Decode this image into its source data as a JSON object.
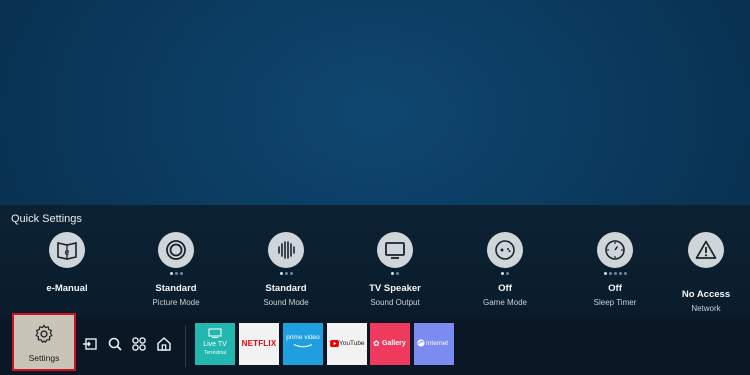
{
  "quick_settings": {
    "title": "Quick Settings",
    "items": [
      {
        "value": "e-Manual",
        "label": "",
        "icon": "e-manual-icon"
      },
      {
        "value": "Standard",
        "label": "Picture Mode",
        "icon": "picture-mode-icon"
      },
      {
        "value": "Standard",
        "label": "Sound Mode",
        "icon": "sound-mode-icon"
      },
      {
        "value": "TV Speaker",
        "label": "Sound Output",
        "icon": "tv-speaker-icon"
      },
      {
        "value": "Off",
        "label": "Game Mode",
        "icon": "gamepad-icon"
      },
      {
        "value": "Off",
        "label": "Sleep Timer",
        "icon": "sleep-timer-icon"
      },
      {
        "value": "No Access",
        "label": "Network",
        "icon": "warning-icon"
      }
    ]
  },
  "bottom_bar": {
    "settings_label": "Settings",
    "nav_icons": [
      "source-icon",
      "search-icon",
      "apps-icon",
      "home-icon"
    ],
    "apps": [
      {
        "name": "Live TV",
        "sub": "Terrestrial",
        "color": "#22b8b0"
      },
      {
        "name": "NETFLIX",
        "sub": "",
        "color": "#f2f2f2"
      },
      {
        "name": "prime video",
        "sub": "",
        "color": "#1f9fe0"
      },
      {
        "name": "YouTube",
        "sub": "",
        "color": "#f2f2f2"
      },
      {
        "name": "Gallery",
        "sub": "",
        "color": "#ee3a5c"
      },
      {
        "name": "Internet",
        "sub": "",
        "color": "#7a8cf0"
      }
    ]
  },
  "colors": {
    "focus_border": "#d10f1f",
    "background": "#0b3a5e"
  }
}
